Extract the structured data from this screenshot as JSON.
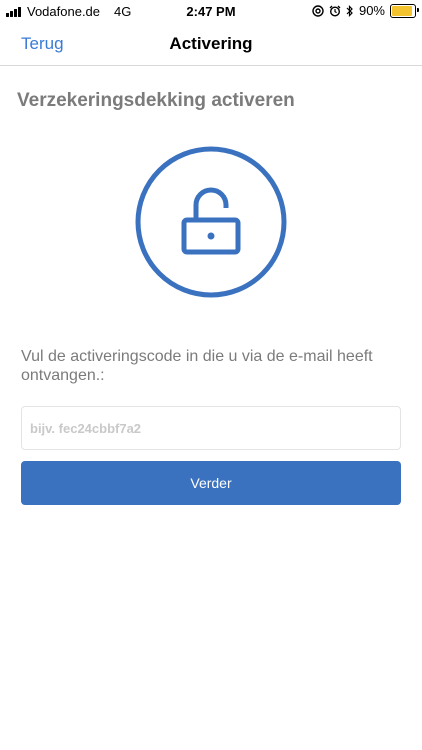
{
  "status_bar": {
    "carrier": "Vodafone.de",
    "network": "4G",
    "time": "2:47 PM",
    "battery_percent": "90%",
    "battery_level": 0.9,
    "icons": [
      "signal-icon",
      "at-sign-icon",
      "alarm-icon",
      "bluetooth-icon",
      "battery-icon"
    ]
  },
  "nav": {
    "back_label": "Terug",
    "title": "Activering"
  },
  "main": {
    "heading": "Verzekeringsdekking activeren",
    "icon": "unlocked-padlock-icon",
    "instruction": "Vul de activeringscode in die u via de e-mail heeft ontvangen.:",
    "code_input": {
      "value": "",
      "placeholder": "bijv. fec24cbbf7a2"
    },
    "next_button_label": "Verder"
  },
  "colors": {
    "accent": "#3a72c0",
    "link": "#3a7bd5",
    "muted_text": "#7b7b7b",
    "battery": "#f4c430"
  }
}
